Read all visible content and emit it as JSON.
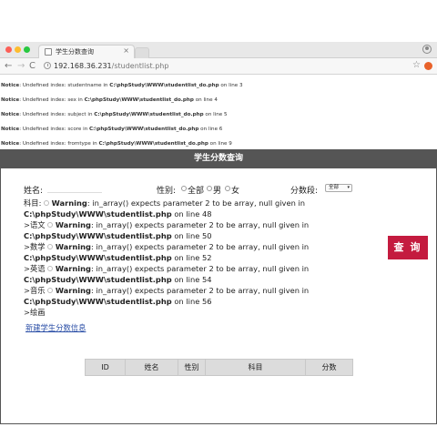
{
  "browser": {
    "tab_title": "学生分数查询",
    "tab_close": "×",
    "url_host": "192.168.36.231",
    "url_path": "/studentlist.php"
  },
  "notices": [
    {
      "label": "Notice",
      "text": ": Undefined index: studentname in ",
      "file": "C:\\phpStudy\\WWW\\studentlist_do.php",
      "tail": " on line 3"
    },
    {
      "label": "Notice",
      "text": ": Undefined index: sex in ",
      "file": "C:\\phpStudy\\WWW\\studentlist_do.php",
      "tail": " on line 4"
    },
    {
      "label": "Notice",
      "text": ": Undefined index: subject in ",
      "file": "C:\\phpStudy\\WWW\\studentlist_do.php",
      "tail": " on line 5"
    },
    {
      "label": "Notice",
      "text": ": Undefined index: score in ",
      "file": "C:\\phpStudy\\WWW\\studentlist_do.php",
      "tail": " on line 6"
    },
    {
      "label": "Notice",
      "text": ": Undefined index: fromtype in ",
      "file": "C:\\phpStudy\\WWW\\studentlist_do.php",
      "tail": " on line 9"
    }
  ],
  "form": {
    "header": "学生分数查询",
    "name_label": "姓名:",
    "name_value": "",
    "sex_label": "性别:",
    "sex_options": [
      "全部",
      "男",
      "女"
    ],
    "score_label": "分数段:",
    "score_selected": "全部",
    "subject_label": "科目:",
    "query_button": "查 询",
    "add_link": "新建学生分数信息"
  },
  "warnings": [
    {
      "prefix": "科目:",
      "label": "Warning",
      "text": ": in_array() expects parameter 2 to be array, null given in",
      "file": "C:\\phpStudy\\WWW\\studentlist.php",
      "tail": " on line 48"
    },
    {
      "prefix": ">语文",
      "label": "Warning",
      "text": ": in_array() expects parameter 2 to be array, null given in",
      "file": "C:\\phpStudy\\WWW\\studentlist.php",
      "tail": " on line 50"
    },
    {
      "prefix": ">数学",
      "label": "Warning",
      "text": ": in_array() expects parameter 2 to be array, null given in",
      "file": "C:\\phpStudy\\WWW\\studentlist.php",
      "tail": " on line 52"
    },
    {
      "prefix": ">英语",
      "label": "Warning",
      "text": ": in_array() expects parameter 2 to be array, null given in",
      "file": "C:\\phpStudy\\WWW\\studentlist.php",
      "tail": " on line 54"
    },
    {
      "prefix": ">音乐",
      "label": "Warning",
      "text": ": in_array() expects parameter 2 to be array, null given in",
      "file": "C:\\phpStudy\\WWW\\studentlist.php",
      "tail": " on line 56"
    }
  ],
  "last_subject": ">绘画",
  "table": {
    "columns": [
      "ID",
      "姓名",
      "性别",
      "科目",
      "分数"
    ]
  },
  "colors": {
    "header_bg": "#555555",
    "query_button": "#c41b3f",
    "link": "#2a4ea6"
  }
}
